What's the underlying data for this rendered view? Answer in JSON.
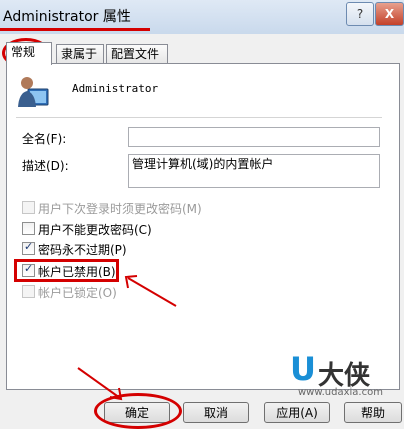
{
  "window": {
    "title": "Administrator 属性",
    "help_button": "?",
    "close_button": "X"
  },
  "tabs": [
    {
      "label": "常规",
      "active": true
    },
    {
      "label": "隶属于",
      "active": false
    },
    {
      "label": "配置文件",
      "active": false
    }
  ],
  "account": {
    "username": "Administrator"
  },
  "fields": {
    "fullname_label": "全名(F):",
    "fullname_value": "",
    "description_label": "描述(D):",
    "description_value": "管理计算机(域)的内置帐户"
  },
  "checkboxes": [
    {
      "label": "用户下次登录时须更改密码(M)",
      "checked": false,
      "enabled": false
    },
    {
      "label": "用户不能更改密码(C)",
      "checked": false,
      "enabled": true
    },
    {
      "label": "密码永不过期(P)",
      "checked": true,
      "enabled": true
    },
    {
      "label": "帐户已禁用(B)",
      "checked": true,
      "enabled": true
    },
    {
      "label": "帐户已锁定(O)",
      "checked": false,
      "enabled": false
    }
  ],
  "buttons": {
    "ok": "确定",
    "cancel": "取消",
    "apply": "应用(A)",
    "help": "帮助"
  },
  "watermark": {
    "logo_u": "U",
    "logo_text": "大侠",
    "url": "www.udaxia.com"
  },
  "colors": {
    "annotation": "#d40000",
    "brand_blue": "#1a8fd6"
  }
}
